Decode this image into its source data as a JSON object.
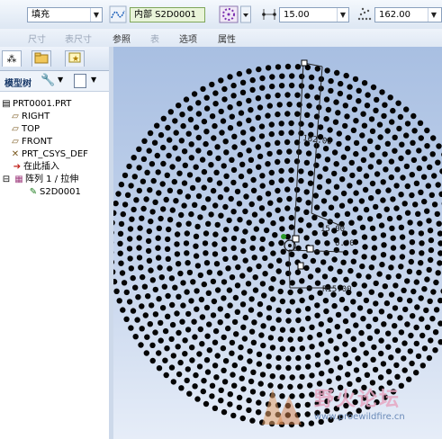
{
  "toolbar": {
    "fill_type": "填充",
    "sketch_ref": "内部 S2D0001",
    "spacing": "15.00",
    "angle": "162.00"
  },
  "tabs": [
    "尺寸",
    "表尺寸",
    "参照",
    "表",
    "选项",
    "属性"
  ],
  "panel": {
    "tree_label": "模型树"
  },
  "tree": [
    {
      "label": "PRT0001.PRT",
      "icon": "part-icon"
    },
    {
      "label": "RIGHT",
      "icon": "datum-plane-icon"
    },
    {
      "label": "TOP",
      "icon": "datum-plane-icon"
    },
    {
      "label": "FRONT",
      "icon": "datum-plane-icon"
    },
    {
      "label": "PRT_CSYS_DEF",
      "icon": "csys-icon"
    },
    {
      "label": "在此插入",
      "icon": "insert-arrow-icon"
    },
    {
      "label": "阵列 1 / 拉伸",
      "icon": "pattern-icon"
    },
    {
      "label": "S2D0001",
      "icon": "sketch-icon"
    }
  ],
  "dims": {
    "d162": "162.00",
    "d15": "15.00",
    "r15": "R15.00",
    "d0": "0.00"
  },
  "watermark": {
    "cn": "野火论坛",
    "url": "www.proewildfire.cn"
  }
}
